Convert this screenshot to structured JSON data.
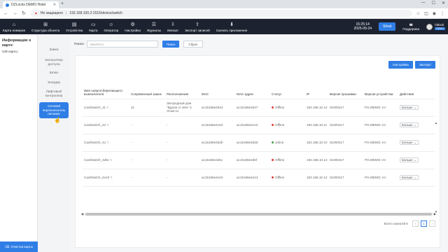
{
  "browser": {
    "tab_title": "DZLocks DEMO Hotel",
    "insecure_label": "Не защищено",
    "url": "192.168.100.2:1515/device/switch"
  },
  "header": {
    "nav": [
      {
        "icon": "map-icon",
        "glyph": "⌂",
        "label": "Карта номеров"
      },
      {
        "icon": "structure-icon",
        "glyph": "⊞",
        "label": "Структура объекта"
      },
      {
        "icon": "devices-icon",
        "glyph": "▤",
        "label": "Устройства"
      },
      {
        "icon": "card-icon",
        "glyph": "▭",
        "label": "Карта"
      },
      {
        "icon": "operator-icon",
        "glyph": "☺",
        "label": "Оператор"
      },
      {
        "icon": "settings-icon",
        "glyph": "⚙",
        "label": "Настройка"
      },
      {
        "icon": "journal-icon",
        "glyph": "☰",
        "label": "Журналы"
      },
      {
        "icon": "import-icon",
        "glyph": "⇩",
        "label": "Импорт"
      },
      {
        "icon": "export-icon",
        "glyph": "⇧",
        "label": "Экспорт записей"
      },
      {
        "icon": "download-icon",
        "glyph": "⬇",
        "label": "Скачать приложение"
      }
    ],
    "time": "15:25:14",
    "date": "2025-09-24",
    "site_button": "Silvat",
    "support": "Поддержка",
    "user_name": "hitlock",
    "user_badge": "DEMO"
  },
  "left_panel": {
    "title": "Информация о карте",
    "uid_label": "UID карты:",
    "clear_button": "Очистка карты"
  },
  "category_menu": [
    {
      "label": "Замок",
      "active": false
    },
    {
      "label": "Контроллер доступа",
      "active": false
    },
    {
      "label": "Шлюз",
      "active": false
    },
    {
      "label": "Энкодер",
      "active": false
    },
    {
      "label": "Лифтовый контроллер",
      "active": false
    },
    {
      "label": "Сетевой переключатель питания",
      "active": true
    }
  ],
  "search": {
    "label": "Поиск:",
    "placeholder": "Имя/MAC",
    "search_button": "Поиск",
    "reset_button": "Сброс"
  },
  "toolbar": {
    "settings_button": "Настройка",
    "export_button": "Экспорт"
  },
  "table": {
    "columns": [
      "Имя энергосберегающего выключателя",
      "Сопряженный замок",
      "Расположение",
      "MAC",
      "MAC-адрес",
      "Статус",
      "IP",
      "Версия прошивки",
      "Версия устройства",
      "Действия"
    ],
    "rows": [
      {
        "name": "CardSwitch_11",
        "lock": "11",
        "location": "Загородный дом \"Вдали от жён\"-1 Этаж-11",
        "mac": "ac15186e4b44",
        "mac_addr": "ac15186e4b47",
        "status": "Offline",
        "online": false,
        "ip": "192.168.10.14",
        "fw": "01000417",
        "hw": "PS-ZBW01 V4",
        "action": "Больше"
      },
      {
        "name": "CardSwitch_42",
        "lock": "-",
        "location": "-",
        "mac": "ac15186e4ce0",
        "mac_addr": "ac15186e4ce3",
        "status": "Offline",
        "online": false,
        "ip": "192.168.10.11",
        "fw": "01000417",
        "hw": "PS-ZBW01 V4",
        "action": "Больше"
      },
      {
        "name": "CardSwitch_41",
        "lock": "-",
        "location": "-",
        "mac": "ac15186e4bd0",
        "mac_addr": "ac15186e4bd3",
        "status": "online",
        "online": true,
        "ip": "192.168.10.10",
        "fw": "01000417",
        "hw": "PS-ZBW01 V4",
        "action": "Больше"
      },
      {
        "name": "CardSwitch_4d5c",
        "lock": "-",
        "location": "-",
        "mac": "ac15186e4d5c",
        "mac_addr": "ac15186e4d5f",
        "status": "Offline",
        "online": false,
        "ip": "192.168.10.13",
        "fw": "01000417",
        "hw": "PS-ZBW01 V4",
        "action": "Больше"
      },
      {
        "name": "CardSwitch_4e10",
        "lock": "-",
        "location": "-",
        "mac": "ac15186e4e10",
        "mac_addr": "ac15186e4e13",
        "status": "Offline",
        "online": false,
        "ip": "192.168.10.12",
        "fw": "01000417",
        "hw": "PS-ZBW01 V4",
        "action": "Больше"
      }
    ]
  },
  "pagination": {
    "total": "Всего записей 5",
    "current": "1"
  },
  "colors": {
    "primary": "#2f7ee6",
    "header_bg": "#1c2230",
    "offline": "#e53935",
    "online": "#43a047"
  }
}
